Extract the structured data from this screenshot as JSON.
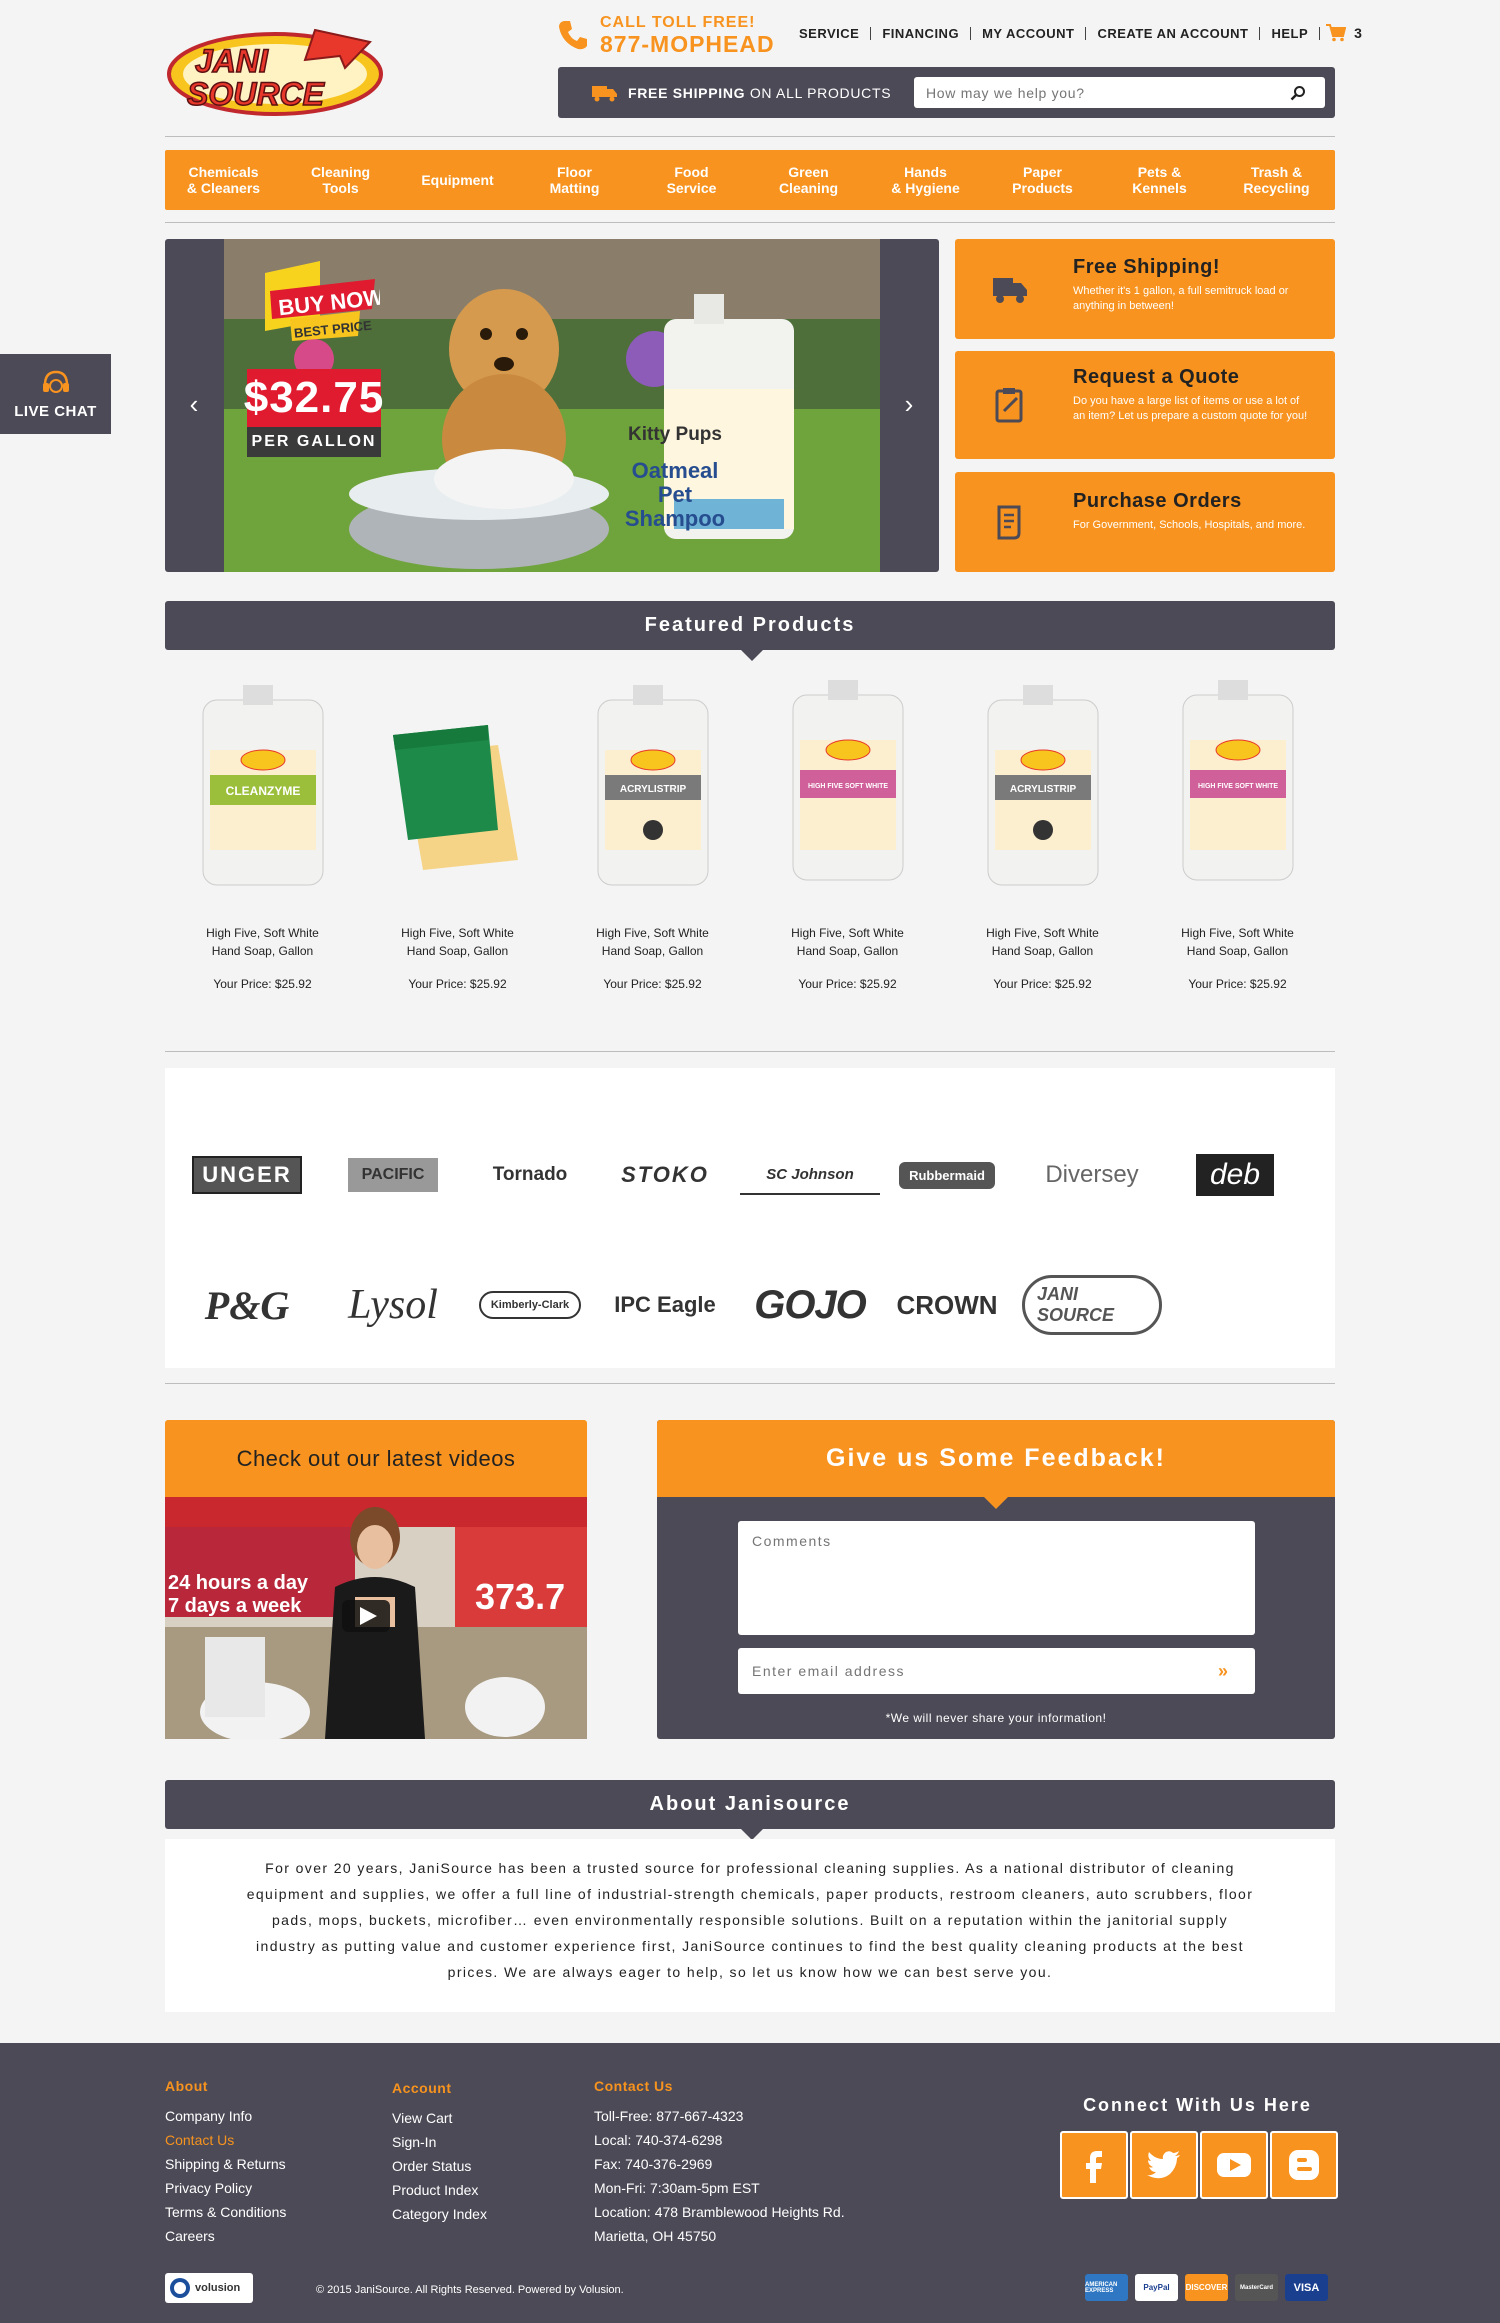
{
  "header": {
    "phone_label": "CALL TOLL FREE!",
    "phone_number": "877-MOPHEAD",
    "top_links": [
      "SERVICE",
      "FINANCING",
      "MY ACCOUNT",
      "CREATE AN ACCOUNT",
      "HELP"
    ],
    "cart_count": "3",
    "shipping_bold": "FREE SHIPPING",
    "shipping_rest": " ON ALL PRODUCTS",
    "search_placeholder": "How may we help you?"
  },
  "logo": {
    "line1": "JANI",
    "line2": "SOURCE"
  },
  "categories": [
    "Chemicals\n& Cleaners",
    "Cleaning\nTools",
    "Equipment",
    "Floor\nMatting",
    "Food\nService",
    "Green\nCleaning",
    "Hands\n& Hygiene",
    "Paper\nProducts",
    "Pets &\nKennels",
    "Trash &\nRecycling"
  ],
  "slider": {
    "buy_now": "BUY NOW",
    "best_price": "BEST PRICE",
    "price": "$32.75",
    "per_gallon": "PER GALLON",
    "product_brand": "Kitty Pups",
    "product_name": "Oatmeal\nPet Shampoo"
  },
  "promos": [
    {
      "title": "Free Shipping!",
      "desc": "Whether it's 1 gallon, a full semitruck load or anything in between!",
      "icon": "truck-icon"
    },
    {
      "title": "Request a Quote",
      "desc": "Do you have a large list of items or use a lot of an item? Let us prepare a custom quote for you!",
      "icon": "clipboard-icon"
    },
    {
      "title": "Purchase Orders",
      "desc": "For Government, Schools, Hospitals, and more.",
      "icon": "document-icon"
    }
  ],
  "featured": {
    "title": "Featured Products",
    "products": [
      {
        "name": "High Five, Soft White\nHand Soap, Gallon",
        "price": "Your Price: $25.92",
        "label": "CLEANZYME"
      },
      {
        "name": "High Five, Soft White\nHand Soap, Gallon",
        "price": "Your Price: $25.92",
        "label": "sponge"
      },
      {
        "name": "High Five, Soft White\nHand Soap, Gallon",
        "price": "Your Price: $25.92",
        "label": "ACRYLISTRIP"
      },
      {
        "name": "High Five, Soft White\nHand Soap, Gallon",
        "price": "Your Price: $25.92",
        "label": "HIGH FIVE SOFT WHITE"
      },
      {
        "name": "High Five, Soft White\nHand Soap, Gallon",
        "price": "Your Price: $25.92",
        "label": "ACRYLISTRIP"
      },
      {
        "name": "High Five, Soft White\nHand Soap, Gallon",
        "price": "Your Price: $25.92",
        "label": "HIGH FIVE SOFT WHITE"
      }
    ]
  },
  "brands": [
    "UNGER",
    "PACIFIC",
    "Tornado",
    "STOKO",
    "SC Johnson",
    "Rubbermaid",
    "Diversey",
    "deb",
    "P&G",
    "Lysol",
    "Kimberly-Clark",
    "IPC Eagle",
    "GOJO",
    "CROWN",
    "JANI SOURCE"
  ],
  "video": {
    "title": "Check out our latest videos",
    "overlay1": "24 hours a day",
    "overlay2": "7 days a week",
    "overlay3": "373.7"
  },
  "feedback": {
    "title": "Give us Some Feedback!",
    "comments_placeholder": "Comments",
    "email_placeholder": "Enter email address",
    "note": "*We will never share your information!"
  },
  "about": {
    "title": "About Janisource",
    "text": "For over 20 years, JaniSource has been a trusted source for professional cleaning supplies. As a national distributor of cleaning equipment and supplies, we offer a full line of industrial-strength chemicals, paper products, restroom cleaners, auto scrubbers, floor pads, mops, buckets, microfiber… even environmentally responsible solutions. Built on a reputation within the janitorial supply industry as putting value and customer experience first, JaniSource continues to find the best quality cleaning products at the best prices. We are always eager to help, so let us know how we can best serve you."
  },
  "footer": {
    "about_title": "About",
    "about_links": [
      "Company Info",
      "Contact Us",
      "Shipping & Returns",
      "Privacy Policy",
      "Terms & Conditions",
      "Careers"
    ],
    "account_title": "Account",
    "account_links": [
      "View Cart",
      "Sign-In",
      "Order Status",
      "Product Index",
      "Category Index"
    ],
    "contact_title": "Contact Us",
    "contact_lines": [
      "Toll-Free: 877-667-4323",
      "Local: 740-374-6298",
      "Fax: 740-376-2969",
      "Mon-Fri: 7:30am-5pm EST",
      "Location: 478 Bramblewood Heights Rd.",
      "Marietta, OH 45750"
    ],
    "connect_title": "Connect With Us Here",
    "socials": [
      "facebook-icon",
      "twitter-icon",
      "youtube-icon",
      "blogger-icon"
    ],
    "copyright": "© 2015 JaniSource. All Rights Reserved. Powered by Volusion.",
    "volusion_badge": "volusion",
    "cards": [
      "AMERICAN EXPRESS",
      "PayPal",
      "DISCOVER",
      "MasterCard",
      "VISA"
    ]
  },
  "livechat": {
    "label": "LIVE CHAT"
  },
  "colors": {
    "accent": "#f7931e",
    "dark": "#4c4a56"
  }
}
